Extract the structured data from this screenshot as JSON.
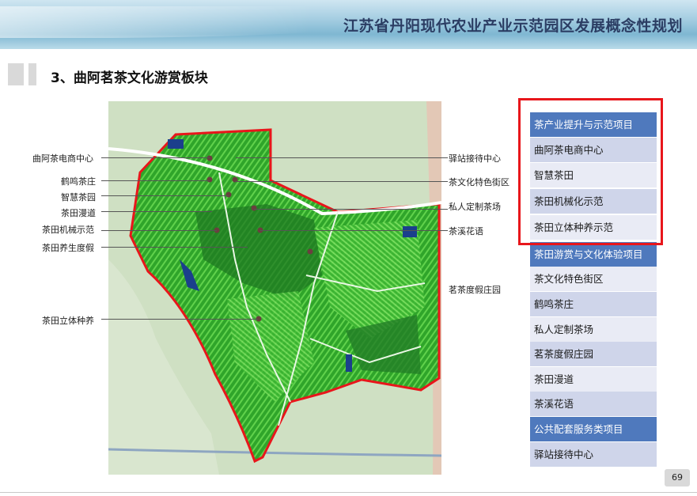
{
  "header": {
    "title": "江苏省丹阳现代农业产业示范园区发展概念性规划"
  },
  "section": {
    "title": "3、曲阿茗茶文化游赏板块"
  },
  "map_labels": {
    "left": [
      "曲阿茶电商中心",
      "鹤鸣茶庄",
      "智慧茶园",
      "茶田漫道",
      "茶田机械示范",
      "茶田养生度假",
      "茶田立体种养"
    ],
    "right": [
      "驿站接待中心",
      "茶文化特色街区",
      "私人定制茶场",
      "茶溪花语",
      "茗茶度假庄园"
    ]
  },
  "legend": {
    "rows": [
      {
        "text": "茶产业提升与示范项目",
        "type": "hdr"
      },
      {
        "text": "曲阿茶电商中心",
        "type": "alt1"
      },
      {
        "text": "智慧茶田",
        "type": "alt2"
      },
      {
        "text": "茶田机械化示范",
        "type": "alt1"
      },
      {
        "text": "茶田立体种养示范",
        "type": "alt2"
      },
      {
        "text": "茶田游赏与文化体验项目",
        "type": "hdr"
      },
      {
        "text": "茶文化特色街区",
        "type": "alt2"
      },
      {
        "text": "鹤鸣茶庄",
        "type": "alt1"
      },
      {
        "text": "私人定制茶场",
        "type": "alt2"
      },
      {
        "text": "茗茶度假庄园",
        "type": "alt1"
      },
      {
        "text": "茶田漫道",
        "type": "alt2"
      },
      {
        "text": "茶溪花语",
        "type": "alt1"
      },
      {
        "text": "公共配套服务类项目",
        "type": "hdr"
      },
      {
        "text": "驿站接待中心",
        "type": "alt1"
      }
    ]
  },
  "page": {
    "number": "69"
  },
  "colors": {
    "highlight": "#e8161b",
    "header_row": "#4f79bd",
    "title": "#2b3d63"
  }
}
